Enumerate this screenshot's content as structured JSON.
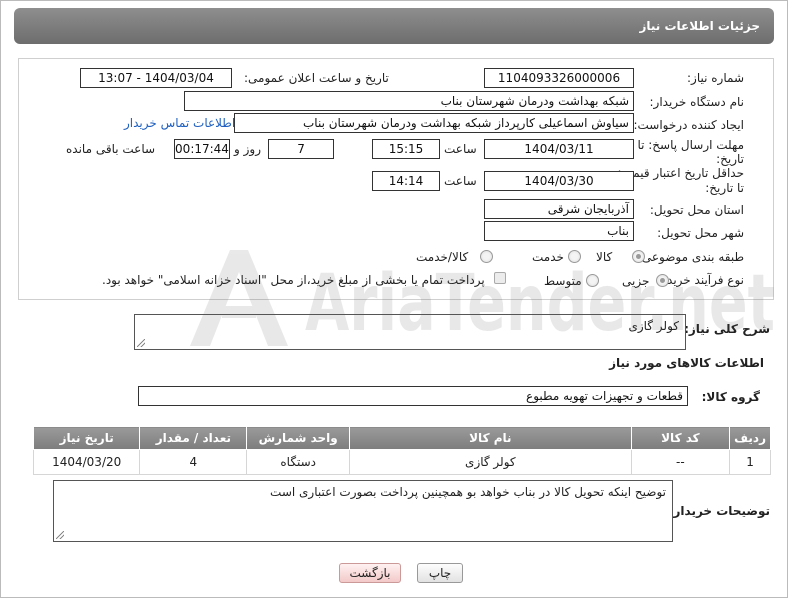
{
  "header": {
    "title": "جزئیات اطلاعات نیاز"
  },
  "form": {
    "need_number": {
      "label": "شماره نیاز:",
      "value": "1104093326000006"
    },
    "announce_datetime": {
      "label": "تاریخ و ساعت اعلان عمومی:",
      "value": "1404/03/04 - 13:07"
    },
    "buyer_org": {
      "label": "نام دستگاه خریدار:",
      "value": "شبکه بهداشت ودرمان شهرستان بناب"
    },
    "creator": {
      "label": "ایجاد کننده درخواست:",
      "value": "سیاوش اسماعیلی کارپرداز شبکه بهداشت ودرمان شهرستان بناب",
      "contact_link": "اطلاعات تماس خریدار"
    },
    "reply_deadline": {
      "label_line1": "مهلت ارسال پاسخ: تا",
      "label_line2": "تاریخ:",
      "date": "1404/03/11",
      "time_label": "ساعت",
      "time": "15:15",
      "days": "7",
      "days_label": "روز و",
      "remaining": "00:17:44",
      "remaining_label": "ساعت باقی مانده"
    },
    "price_validity": {
      "label_line1": "حداقل تاریخ اعتبار قیمت:",
      "label_line2": "تا تاریخ:",
      "date": "1404/03/30",
      "time_label": "ساعت",
      "time": "14:14"
    },
    "delivery_province": {
      "label": "استان محل تحویل:",
      "value": "آذربایجان شرقی"
    },
    "delivery_city": {
      "label": "شهر محل تحویل:",
      "value": "بناب"
    },
    "category": {
      "label": "طبقه بندی موضوعی:",
      "options": [
        "کالا",
        "خدمت",
        "کالا/خدمت"
      ],
      "selected": "کالا"
    },
    "process_type": {
      "label": "نوع فرآیند خرید :",
      "options": [
        "جزیی",
        "متوسط"
      ],
      "selected": "جزیی",
      "payment_note": "پرداخت تمام یا بخشی از مبلغ خرید،از محل \"اسناد خزانه اسلامی\" خواهد بود."
    }
  },
  "description": {
    "label": "شرح کلی نیاز:",
    "value": "کولر گازی"
  },
  "goods_section": {
    "title": "اطلاعات کالاهای مورد نیاز",
    "group_label": "گروه کالا:",
    "group_value": "قطعات و تجهیزات تهویه مطبوع"
  },
  "table": {
    "headers": [
      "ردیف",
      "کد کالا",
      "نام کالا",
      "واحد شمارش",
      "تعداد / مقدار",
      "تاریخ نیاز"
    ],
    "rows": [
      [
        "1",
        "--",
        "کولر گازی",
        "دستگاه",
        "4",
        "1404/03/20"
      ]
    ]
  },
  "buyer_notes": {
    "label": "توضیحات خریدار:",
    "value": "توضیح اینکه تحویل کالا در بناب خواهد بو همچینین پرداخت بصورت اعتباری است"
  },
  "buttons": {
    "print": "چاپ",
    "back": "بازگشت"
  },
  "watermark": {
    "text": "AriaTender.net"
  },
  "colors": {
    "header_bg": "#7a7a7a",
    "link": "#1e5fbf",
    "back_button": "#f3c9c9"
  }
}
